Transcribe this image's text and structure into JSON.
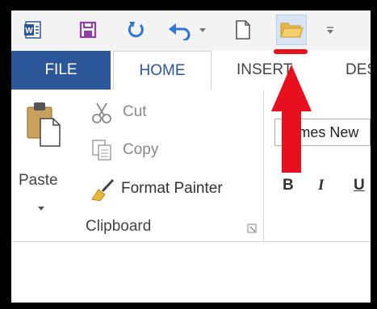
{
  "qat": {
    "icons": [
      "word-app-icon",
      "save-icon",
      "redo-icon",
      "undo-icon",
      "new-document-icon",
      "open-folder-icon",
      "customize-qat-icon"
    ]
  },
  "tabs": {
    "file": "FILE",
    "home": "HOME",
    "insert": "INSERT",
    "design": "DES"
  },
  "clipboard": {
    "paste": "Paste",
    "cut": "Cut",
    "copy": "Copy",
    "format_painter": "Format Painter",
    "group_label": "Clipboard"
  },
  "font": {
    "font_name": "Times New",
    "bold": "B",
    "italic": "I",
    "underline": "U"
  },
  "colors": {
    "file_tab": "#2b579a",
    "annotation_arrow": "#e8101f",
    "qat_highlight": "#d6e4f3"
  }
}
